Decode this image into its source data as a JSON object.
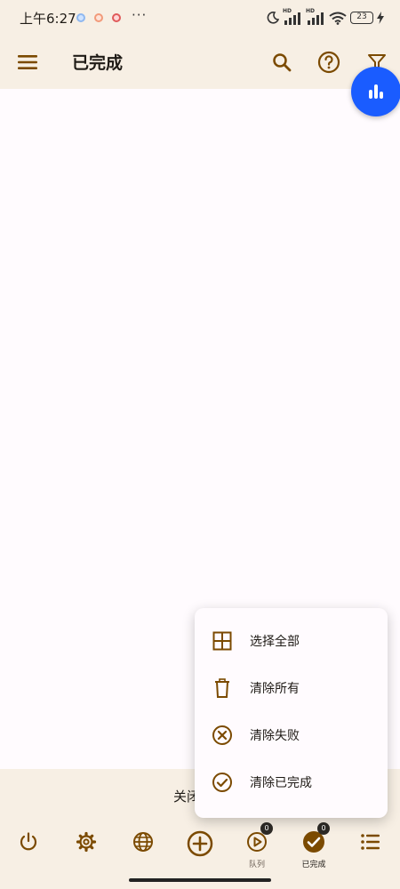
{
  "status_bar": {
    "time": "上午6:27",
    "more": "···",
    "network_badge_1": "HD",
    "network_badge_2": "HD",
    "battery": "23"
  },
  "app_bar": {
    "title": "已完成"
  },
  "bottom_strip": {
    "text": "关闭"
  },
  "menu": {
    "items": [
      {
        "label": "选择全部",
        "icon": "select-all-icon"
      },
      {
        "label": "清除所有",
        "icon": "trash-icon"
      },
      {
        "label": "清除失败",
        "icon": "cancel-circle-icon"
      },
      {
        "label": "清除已完成",
        "icon": "check-circle-icon"
      }
    ]
  },
  "nav": {
    "items": [
      {
        "icon": "power-icon",
        "label": ""
      },
      {
        "icon": "gear-icon",
        "label": ""
      },
      {
        "icon": "globe-icon",
        "label": ""
      },
      {
        "icon": "add-circle-icon",
        "label": ""
      },
      {
        "icon": "play-circle-icon",
        "label": "队列",
        "badge": "0"
      },
      {
        "icon": "check-circle-filled-icon",
        "label": "已完成",
        "badge": "0"
      },
      {
        "icon": "list-icon",
        "label": ""
      }
    ]
  },
  "colors": {
    "accent": "#7b4a00",
    "surface": "#f7efe4",
    "background": "#fffbfe",
    "fab": "#1a5cff"
  }
}
